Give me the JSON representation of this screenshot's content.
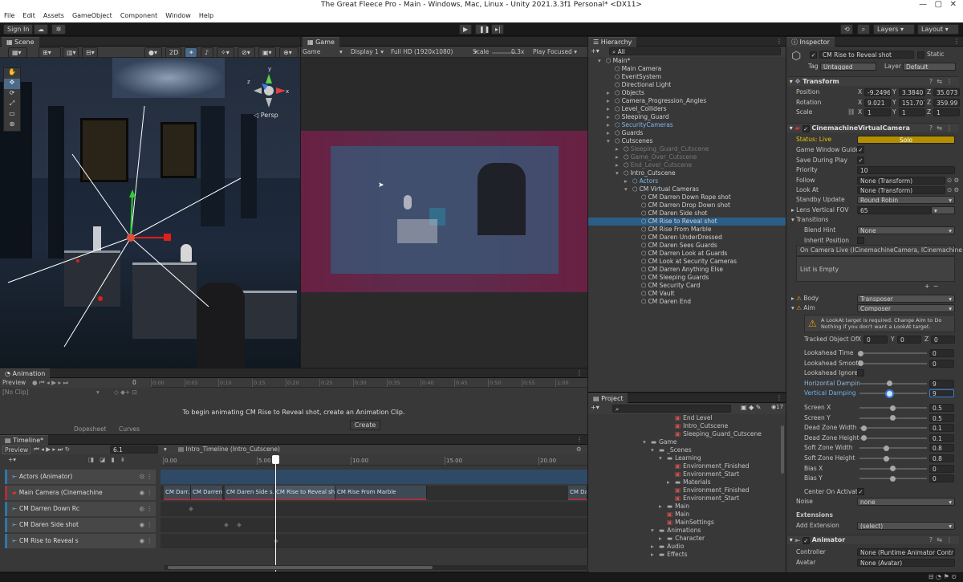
{
  "titlebar": {
    "title": "The Great Fleece Pro - Main - Windows, Mac, Linux - Unity 2021.3.3f1 Personal* <DX11>"
  },
  "menu": [
    "File",
    "Edit",
    "Assets",
    "GameObject",
    "Component",
    "Window",
    "Help"
  ],
  "toolbar": {
    "signin": "Sign In",
    "layers": "Layers",
    "layout": "Layout"
  },
  "scene": {
    "tab": "Scene",
    "mode_2d": "2D",
    "persp": "◁ Persp",
    "axis_x": "x",
    "axis_y": "y",
    "axis_z": "z"
  },
  "game": {
    "tab": "Game",
    "mode": "Game",
    "display": "Display 1",
    "resolution": "Full HD (1920x1080)",
    "scale_label": "Scale",
    "scale_value": "0.3x",
    "play_focused": "Play Focused"
  },
  "hierarchy": {
    "tab": "Hierarchy",
    "search_placeholder": "All",
    "items": [
      {
        "label": "Main*",
        "depth": 0
      },
      {
        "label": "Main Camera",
        "depth": 1
      },
      {
        "label": "EventSystem",
        "depth": 1
      },
      {
        "label": "Directional Light",
        "depth": 1
      },
      {
        "label": "Objects",
        "depth": 1
      },
      {
        "label": "Camera_Progression_Angles",
        "depth": 1
      },
      {
        "label": "Level_Colliders",
        "depth": 1
      },
      {
        "label": "Sleeping_Guard",
        "depth": 1
      },
      {
        "label": "SecurityCameras",
        "depth": 1
      },
      {
        "label": "Guards",
        "depth": 1
      },
      {
        "label": "Cutscenes",
        "depth": 1
      },
      {
        "label": "Sleeping_Guard_Cutscene",
        "depth": 2
      },
      {
        "label": "Game_Over_Cutscene",
        "depth": 2
      },
      {
        "label": "End_Level_Cutscene",
        "depth": 2
      },
      {
        "label": "Intro_Cutscene",
        "depth": 2
      },
      {
        "label": "Actors",
        "depth": 3
      },
      {
        "label": "CM Virtual Cameras",
        "depth": 3
      },
      {
        "label": "CM Darren Down Rope shot",
        "depth": 4
      },
      {
        "label": "CM Darren Drop Down shot",
        "depth": 4
      },
      {
        "label": "CM Daren Side shot",
        "depth": 4
      },
      {
        "label": "CM Rise to Reveal shot",
        "depth": 4
      },
      {
        "label": "CM Rise From Marble",
        "depth": 4
      },
      {
        "label": "CM Daren UnderDressed",
        "depth": 4
      },
      {
        "label": "CM Daren Sees Guards",
        "depth": 4
      },
      {
        "label": "CM Darren Look at Guards",
        "depth": 4
      },
      {
        "label": "CM Look at Security Cameras",
        "depth": 4
      },
      {
        "label": "CM Darren Anything Else",
        "depth": 4
      },
      {
        "label": "CM Sleeping Guards",
        "depth": 4
      },
      {
        "label": "CM Security Card",
        "depth": 4
      },
      {
        "label": "CM Vault",
        "depth": 4
      },
      {
        "label": "CM Daren End",
        "depth": 4
      }
    ]
  },
  "project": {
    "tab": "Project",
    "count": "17",
    "items": [
      {
        "label": "End Level",
        "depth": 3
      },
      {
        "label": "Intro_Cutscene",
        "depth": 3
      },
      {
        "label": "Sleeping_Guard_Cutscene",
        "depth": 3
      },
      {
        "label": "Game",
        "depth": 0
      },
      {
        "label": "_Scenes",
        "depth": 1
      },
      {
        "label": "Learning",
        "depth": 2
      },
      {
        "label": "Environment_Finished",
        "depth": 3
      },
      {
        "label": "Environment_Start",
        "depth": 3
      },
      {
        "label": "Materials",
        "depth": 3
      },
      {
        "label": "Environment_Finished",
        "depth": 3
      },
      {
        "label": "Environment_Start",
        "depth": 3
      },
      {
        "label": "Main",
        "depth": 2
      },
      {
        "label": "Main",
        "depth": 2
      },
      {
        "label": "MainSettings",
        "depth": 2
      },
      {
        "label": "Animations",
        "depth": 1
      },
      {
        "label": "Character",
        "depth": 2
      },
      {
        "label": "Audio",
        "depth": 1
      },
      {
        "label": "Effects",
        "depth": 1
      }
    ]
  },
  "animation": {
    "tab": "Animation",
    "preview": "Preview",
    "frame": "0",
    "clip": "[No Clip]",
    "ticks": [
      "0:00",
      "0:05",
      "0:10",
      "0:15",
      "0:20",
      "0:25",
      "0:30",
      "0:35",
      "0:40",
      "0:45",
      "0:50",
      "0:55",
      "1:00"
    ],
    "message": "To begin animating CM Rise to Reveal shot, create an Animation Clip.",
    "create": "Create",
    "dopesheet": "Dopesheet",
    "curves": "Curves"
  },
  "timeline": {
    "tab": "Timeline*",
    "preview": "Preview",
    "frame": "6.1",
    "asset": "Intro_Timeline (Intro_Cutscene)",
    "ticks": [
      "0.00",
      "5.00",
      "10.00",
      "15.00",
      "20.00"
    ],
    "tracks": [
      "Actors (Animator)",
      "Main Camera (Cinemachine",
      "CM Darren Down Rc",
      "CM Daren Side shot",
      "CM Rise to Reveal s"
    ],
    "clips": [
      "CM Darr...",
      "CM Darren...",
      "CM Daren Side s...",
      "CM Rise to Reveal shot",
      "CM Rise From Marble",
      "CM Da"
    ]
  },
  "inspector": {
    "tab": "Inspector",
    "object_name": "CM Rise to Reveal shot",
    "static": "Static",
    "tag_label": "Tag",
    "tag": "Untagged",
    "layer_label": "Layer",
    "layer": "Default",
    "transform": {
      "title": "Transform",
      "position": "Position",
      "rotation": "Rotation",
      "scale": "Scale",
      "pos": [
        "-9.2496",
        "3.3840",
        "35.073"
      ],
      "rot": [
        "9.021",
        "151.707",
        "359.99"
      ],
      "scl": [
        "1",
        "1",
        "1"
      ]
    },
    "vcam": {
      "title": "CinemachineVirtualCamera",
      "status_label": "Status: Live",
      "solo": "Solo",
      "game_window_guides": "Game Window Guide",
      "save_during_play": "Save During Play",
      "priority_label": "Priority",
      "priority": "10",
      "follow_label": "Follow",
      "follow": "None (Transform)",
      "lookat_label": "Look At",
      "lookat": "None (Transform)",
      "standby_label": "Standby Update",
      "standby": "Round Robin",
      "fov_label": "Lens Vertical FOV",
      "fov": "65",
      "transitions": "Transitions",
      "blend_hint_label": "Blend Hint",
      "blend_hint": "None",
      "inherit_label": "Inherit Position",
      "on_camera_live": "On Camera Live (ICinemachineCamera, ICinemachine",
      "list_empty": "List is Empty",
      "body_label": "Body",
      "body": "Transposer",
      "aim_label": "Aim",
      "aim": "Composer",
      "warning": "A LookAt target is required.  Change Aim to Do Nothing if you don't want a LookAt target.",
      "tracked_label": "Tracked Object Of",
      "tracked": [
        "0",
        "0",
        "0"
      ],
      "params": [
        {
          "label": "Lookahead Time",
          "value": "0",
          "frac": 0
        },
        {
          "label": "Lookahead Smooth",
          "value": "0",
          "frac": 0
        },
        {
          "label": "Lookahead Ignore",
          "value": "",
          "frac": -1
        },
        {
          "label": "Horizontal Dampin",
          "value": "9",
          "frac": 0.45
        },
        {
          "label": "Vertical Damping",
          "value": "9",
          "frac": 0.45
        },
        {
          "label": "Screen X",
          "value": "0.5",
          "frac": 0.5
        },
        {
          "label": "Screen Y",
          "value": "0.5",
          "frac": 0.5
        },
        {
          "label": "Dead Zone Width",
          "value": "0.1",
          "frac": 0.05
        },
        {
          "label": "Dead Zone Height",
          "value": "0.1",
          "frac": 0.05
        },
        {
          "label": "Soft Zone Width",
          "value": "0.8",
          "frac": 0.4
        },
        {
          "label": "Soft Zone Height",
          "value": "0.8",
          "frac": 0.4
        },
        {
          "label": "Bias X",
          "value": "0",
          "frac": 0.5
        },
        {
          "label": "Bias Y",
          "value": "0",
          "frac": 0.5
        }
      ],
      "center_label": "Center On Activat",
      "noise_label": "Noise",
      "noise": "none",
      "extensions": "Extensions",
      "add_ext_label": "Add Extension",
      "add_ext": "(select)"
    },
    "animator": {
      "title": "Animator",
      "controller_label": "Controller",
      "controller": "None (Runtime Animator Contr",
      "avatar_label": "Avatar",
      "avatar": "None (Avatar)"
    }
  },
  "colors": {
    "accent": "#2c5d87",
    "live": "#c8a800",
    "timeline_track": "#2a78a8",
    "clip_red": "#a2333b"
  }
}
